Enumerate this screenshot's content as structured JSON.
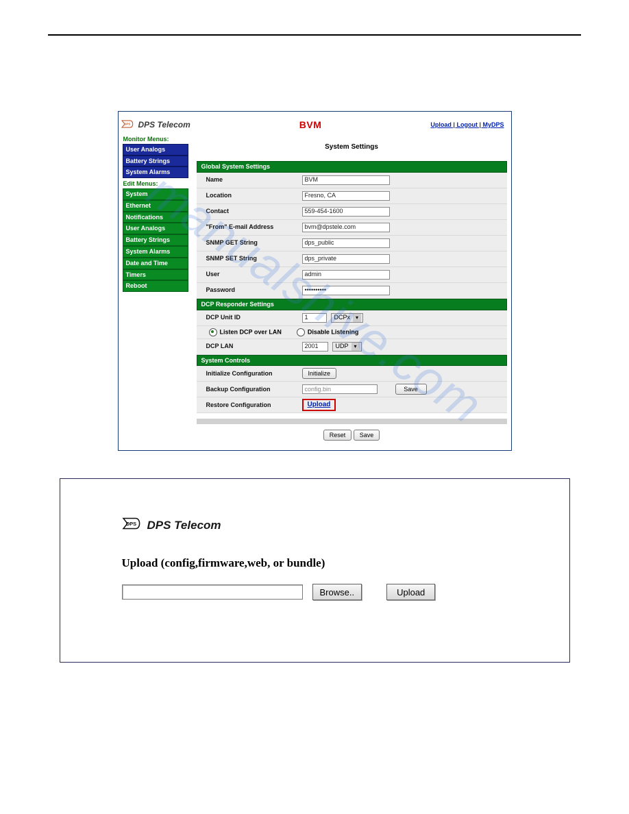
{
  "watermark": "manualshive.com",
  "header": {
    "brand": "DPS Telecom",
    "app_title": "BVM",
    "links": {
      "upload": "Upload",
      "logout": "Logout",
      "mydps": "MyDPS"
    }
  },
  "sidebar": {
    "monitor_heading": "Monitor Menus:",
    "monitor_items": [
      "User Analogs",
      "Battery Strings",
      "System Alarms"
    ],
    "edit_heading": "Edit Menus:",
    "edit_items": [
      "System",
      "Ethernet",
      "Notifications",
      "User Analogs",
      "Battery Strings",
      "System Alarms",
      "Date and Time",
      "Timers",
      "Reboot"
    ]
  },
  "content": {
    "page_title": "System Settings",
    "sections": {
      "global": {
        "title": "Global System Settings",
        "rows": {
          "name": {
            "label": "Name",
            "value": "BVM"
          },
          "location": {
            "label": "Location",
            "value": "Fresno, CA"
          },
          "contact": {
            "label": "Contact",
            "value": "559-454-1600"
          },
          "from_email": {
            "label": "\"From\" E-mail Address",
            "value": "bvm@dpstele.com"
          },
          "snmp_get": {
            "label": "SNMP GET String",
            "value": "dps_public"
          },
          "snmp_set": {
            "label": "SNMP SET String",
            "value": "dps_private"
          },
          "user": {
            "label": "User",
            "value": "admin"
          },
          "password": {
            "label": "Password",
            "value": "••••••••••"
          }
        }
      },
      "dcp": {
        "title": "DCP Responder Settings",
        "unit_id": {
          "label": "DCP Unit ID",
          "value": "1",
          "protocol": "DCPx"
        },
        "radios": {
          "listen": "Listen DCP over LAN",
          "disable": "Disable Listening"
        },
        "lan": {
          "label": "DCP LAN",
          "port": "2001",
          "proto": "UDP"
        }
      },
      "controls": {
        "title": "System Controls",
        "init": {
          "label": "Initialize Configuration",
          "btn": "Initialize"
        },
        "backup": {
          "label": "Backup Configuration",
          "file": "config.bin",
          "btn": "Save"
        },
        "restore": {
          "label": "Restore Configuration",
          "link": "Upload"
        }
      }
    },
    "bottom": {
      "reset": "Reset",
      "save": "Save"
    }
  },
  "fig2": {
    "brand": "DPS Telecom",
    "title": "Upload (config,firmware,web, or bundle)",
    "browse": "Browse..",
    "upload": "Upload"
  }
}
